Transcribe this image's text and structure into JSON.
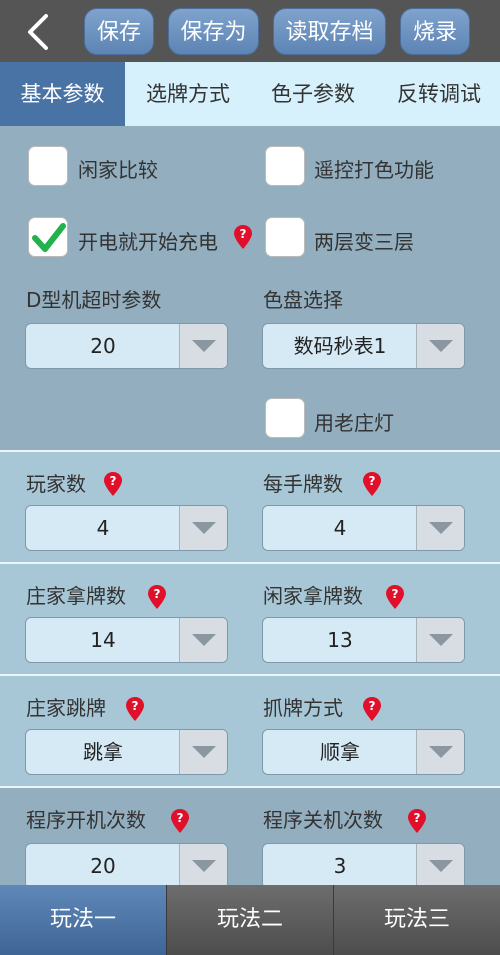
{
  "toolbar": {
    "buttons": [
      "保存",
      "保存为",
      "读取存档",
      "烧录"
    ]
  },
  "tabs": [
    "基本参数",
    "选牌方式",
    "色子参数",
    "反转调试"
  ],
  "options": {
    "xian_jia_bi_jiao": {
      "label": "闲家比较",
      "checked": false
    },
    "yao_kong": {
      "label": "遥控打色功能",
      "checked": false
    },
    "kai_dian": {
      "label": "开电就开始充电",
      "checked": true
    },
    "liang_ceng": {
      "label": "两层变三层",
      "checked": false
    },
    "lao_zhuang_deng": {
      "label": "用老庄灯",
      "checked": false
    }
  },
  "fields": {
    "d_timeout": {
      "label": "D型机超时参数",
      "value": "20"
    },
    "se_pan": {
      "label": "色盘选择",
      "value": "数码秒表1"
    },
    "players": {
      "label": "玩家数",
      "value": "4"
    },
    "per_hand": {
      "label": "每手牌数",
      "value": "4"
    },
    "banker_take": {
      "label": "庄家拿牌数",
      "value": "14"
    },
    "idle_take": {
      "label": "闲家拿牌数",
      "value": "13"
    },
    "banker_jump": {
      "label": "庄家跳牌",
      "value": "跳拿"
    },
    "grab_mode": {
      "label": "抓牌方式",
      "value": "顺拿"
    },
    "power_on": {
      "label": "程序开机次数",
      "value": "20"
    },
    "power_off": {
      "label": "程序关机次数",
      "value": "3"
    }
  },
  "bottom_tabs": [
    "玩法一",
    "玩法二",
    "玩法三"
  ]
}
